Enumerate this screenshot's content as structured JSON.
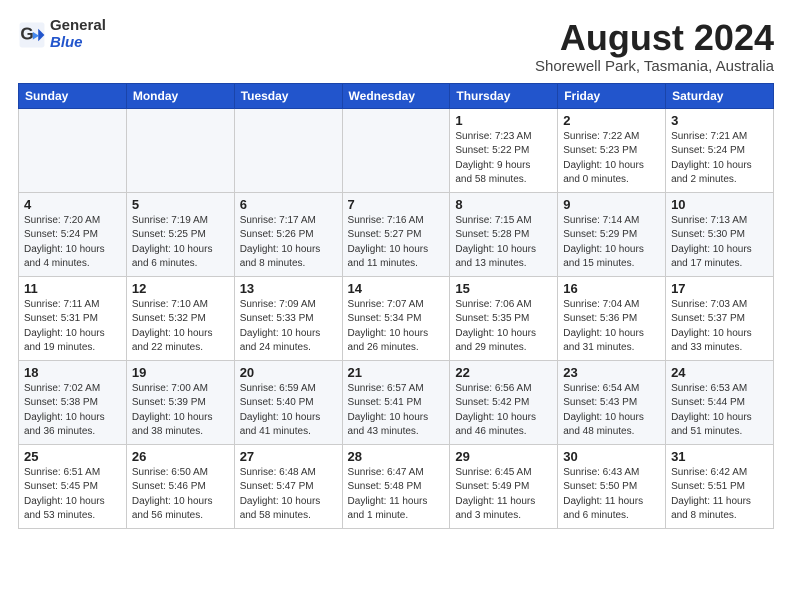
{
  "header": {
    "logo_general": "General",
    "logo_blue": "Blue",
    "title": "August 2024",
    "subtitle": "Shorewell Park, Tasmania, Australia"
  },
  "weekdays": [
    "Sunday",
    "Monday",
    "Tuesday",
    "Wednesday",
    "Thursday",
    "Friday",
    "Saturday"
  ],
  "weeks": [
    [
      {
        "day": "",
        "info": ""
      },
      {
        "day": "",
        "info": ""
      },
      {
        "day": "",
        "info": ""
      },
      {
        "day": "",
        "info": ""
      },
      {
        "day": "1",
        "info": "Sunrise: 7:23 AM\nSunset: 5:22 PM\nDaylight: 9 hours\nand 58 minutes."
      },
      {
        "day": "2",
        "info": "Sunrise: 7:22 AM\nSunset: 5:23 PM\nDaylight: 10 hours\nand 0 minutes."
      },
      {
        "day": "3",
        "info": "Sunrise: 7:21 AM\nSunset: 5:24 PM\nDaylight: 10 hours\nand 2 minutes."
      }
    ],
    [
      {
        "day": "4",
        "info": "Sunrise: 7:20 AM\nSunset: 5:24 PM\nDaylight: 10 hours\nand 4 minutes."
      },
      {
        "day": "5",
        "info": "Sunrise: 7:19 AM\nSunset: 5:25 PM\nDaylight: 10 hours\nand 6 minutes."
      },
      {
        "day": "6",
        "info": "Sunrise: 7:17 AM\nSunset: 5:26 PM\nDaylight: 10 hours\nand 8 minutes."
      },
      {
        "day": "7",
        "info": "Sunrise: 7:16 AM\nSunset: 5:27 PM\nDaylight: 10 hours\nand 11 minutes."
      },
      {
        "day": "8",
        "info": "Sunrise: 7:15 AM\nSunset: 5:28 PM\nDaylight: 10 hours\nand 13 minutes."
      },
      {
        "day": "9",
        "info": "Sunrise: 7:14 AM\nSunset: 5:29 PM\nDaylight: 10 hours\nand 15 minutes."
      },
      {
        "day": "10",
        "info": "Sunrise: 7:13 AM\nSunset: 5:30 PM\nDaylight: 10 hours\nand 17 minutes."
      }
    ],
    [
      {
        "day": "11",
        "info": "Sunrise: 7:11 AM\nSunset: 5:31 PM\nDaylight: 10 hours\nand 19 minutes."
      },
      {
        "day": "12",
        "info": "Sunrise: 7:10 AM\nSunset: 5:32 PM\nDaylight: 10 hours\nand 22 minutes."
      },
      {
        "day": "13",
        "info": "Sunrise: 7:09 AM\nSunset: 5:33 PM\nDaylight: 10 hours\nand 24 minutes."
      },
      {
        "day": "14",
        "info": "Sunrise: 7:07 AM\nSunset: 5:34 PM\nDaylight: 10 hours\nand 26 minutes."
      },
      {
        "day": "15",
        "info": "Sunrise: 7:06 AM\nSunset: 5:35 PM\nDaylight: 10 hours\nand 29 minutes."
      },
      {
        "day": "16",
        "info": "Sunrise: 7:04 AM\nSunset: 5:36 PM\nDaylight: 10 hours\nand 31 minutes."
      },
      {
        "day": "17",
        "info": "Sunrise: 7:03 AM\nSunset: 5:37 PM\nDaylight: 10 hours\nand 33 minutes."
      }
    ],
    [
      {
        "day": "18",
        "info": "Sunrise: 7:02 AM\nSunset: 5:38 PM\nDaylight: 10 hours\nand 36 minutes."
      },
      {
        "day": "19",
        "info": "Sunrise: 7:00 AM\nSunset: 5:39 PM\nDaylight: 10 hours\nand 38 minutes."
      },
      {
        "day": "20",
        "info": "Sunrise: 6:59 AM\nSunset: 5:40 PM\nDaylight: 10 hours\nand 41 minutes."
      },
      {
        "day": "21",
        "info": "Sunrise: 6:57 AM\nSunset: 5:41 PM\nDaylight: 10 hours\nand 43 minutes."
      },
      {
        "day": "22",
        "info": "Sunrise: 6:56 AM\nSunset: 5:42 PM\nDaylight: 10 hours\nand 46 minutes."
      },
      {
        "day": "23",
        "info": "Sunrise: 6:54 AM\nSunset: 5:43 PM\nDaylight: 10 hours\nand 48 minutes."
      },
      {
        "day": "24",
        "info": "Sunrise: 6:53 AM\nSunset: 5:44 PM\nDaylight: 10 hours\nand 51 minutes."
      }
    ],
    [
      {
        "day": "25",
        "info": "Sunrise: 6:51 AM\nSunset: 5:45 PM\nDaylight: 10 hours\nand 53 minutes."
      },
      {
        "day": "26",
        "info": "Sunrise: 6:50 AM\nSunset: 5:46 PM\nDaylight: 10 hours\nand 56 minutes."
      },
      {
        "day": "27",
        "info": "Sunrise: 6:48 AM\nSunset: 5:47 PM\nDaylight: 10 hours\nand 58 minutes."
      },
      {
        "day": "28",
        "info": "Sunrise: 6:47 AM\nSunset: 5:48 PM\nDaylight: 11 hours\nand 1 minute."
      },
      {
        "day": "29",
        "info": "Sunrise: 6:45 AM\nSunset: 5:49 PM\nDaylight: 11 hours\nand 3 minutes."
      },
      {
        "day": "30",
        "info": "Sunrise: 6:43 AM\nSunset: 5:50 PM\nDaylight: 11 hours\nand 6 minutes."
      },
      {
        "day": "31",
        "info": "Sunrise: 6:42 AM\nSunset: 5:51 PM\nDaylight: 11 hours\nand 8 minutes."
      }
    ]
  ]
}
